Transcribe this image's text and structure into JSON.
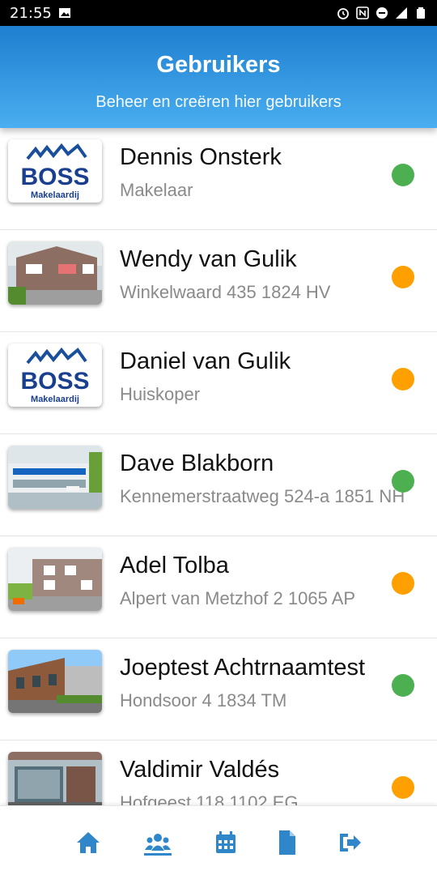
{
  "status_bar": {
    "time": "21:55"
  },
  "header": {
    "title": "Gebruikers",
    "subtitle": "Beheer en creëren hier gebruikers"
  },
  "logo": {
    "brand": "BOSS",
    "tagline": "Makelaardij"
  },
  "colors": {
    "accent": "#2f86c9",
    "green": "#4caf50",
    "orange": "#ffa000"
  },
  "users": [
    {
      "name": "Dennis Onsterk",
      "subtitle": "Makelaar",
      "status": "green",
      "thumb": "boss-logo"
    },
    {
      "name": "Wendy van Gulik",
      "subtitle": "Winkelwaard 435 1824 HV",
      "status": "orange",
      "thumb": "house-photo"
    },
    {
      "name": "Daniel van Gulik",
      "subtitle": "Huiskoper",
      "status": "orange",
      "thumb": "boss-logo"
    },
    {
      "name": "Dave Blakborn",
      "subtitle": "Kennemerstraatweg 524-a 1851 NH",
      "status": "green",
      "thumb": "house-photo"
    },
    {
      "name": "Adel Tolba",
      "subtitle": "Alpert van Metzhof 2 1065 AP",
      "status": "orange",
      "thumb": "house-photo"
    },
    {
      "name": "Joeptest Achtrnaamtest",
      "subtitle": "Hondsoor 4 1834 TM",
      "status": "green",
      "thumb": "house-photo"
    },
    {
      "name": "Valdimir Valdés",
      "subtitle": "Hofgeest 118 1102 EG",
      "status": "orange",
      "thumb": "house-photo"
    }
  ],
  "tabs": [
    {
      "icon": "home-icon",
      "active": false
    },
    {
      "icon": "users-icon",
      "active": true
    },
    {
      "icon": "calendar-icon",
      "active": false
    },
    {
      "icon": "document-icon",
      "active": false
    },
    {
      "icon": "logout-icon",
      "active": false
    }
  ]
}
